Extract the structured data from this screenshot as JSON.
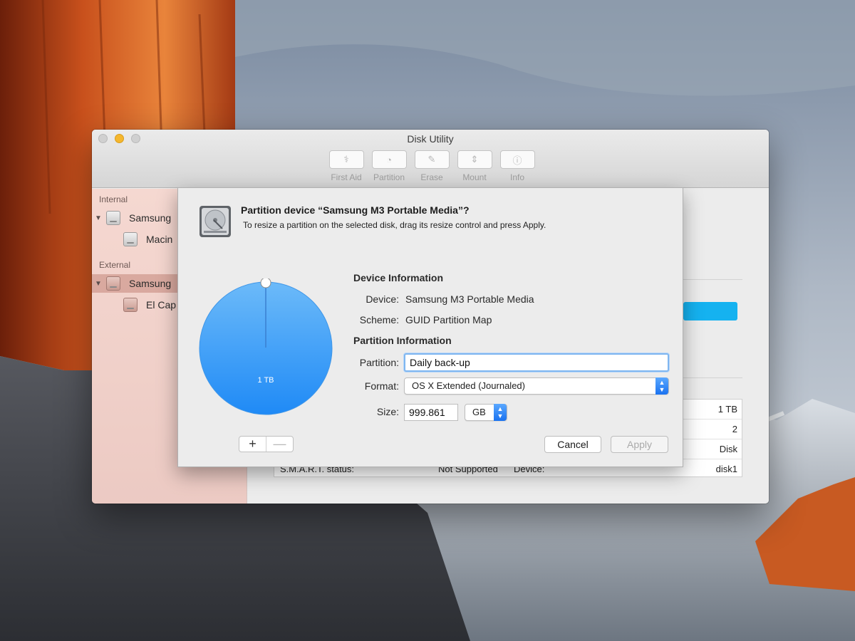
{
  "window": {
    "title": "Disk Utility",
    "toolbar": [
      {
        "label": "First Aid",
        "icon": "stethoscope-icon",
        "glyph": "⚕"
      },
      {
        "label": "Partition",
        "icon": "partition-pie-icon",
        "glyph": "◔"
      },
      {
        "label": "Erase",
        "icon": "erase-icon",
        "glyph": "✎"
      },
      {
        "label": "Mount",
        "icon": "mount-icon",
        "glyph": "⇕"
      },
      {
        "label": "Info",
        "icon": "info-icon",
        "glyph": "ⓘ"
      }
    ]
  },
  "sidebar": {
    "internal_label": "Internal",
    "external_label": "External",
    "items": [
      {
        "label": "Samsung",
        "type": "disk",
        "section": "internal"
      },
      {
        "label": "Macin",
        "type": "volume",
        "section": "internal"
      },
      {
        "label": "Samsung",
        "type": "disk",
        "section": "external",
        "selected": true
      },
      {
        "label": "El Cap",
        "type": "volume",
        "section": "external"
      }
    ]
  },
  "info_table": {
    "rows": [
      {
        "value": "1 TB"
      },
      {
        "value": "2"
      },
      {
        "value": "Disk"
      },
      {
        "label": "S.M.A.R.T. status:",
        "mid": "Not Supported",
        "label2": "Device:",
        "value": "disk1"
      }
    ]
  },
  "sheet": {
    "title": "Partition device “Samsung M3 Portable Media”?",
    "subtitle": "To resize a partition on the selected disk, drag its resize control and press Apply.",
    "pie": {
      "label": "1 TB",
      "color_top": "#6cbaf9",
      "color_bottom": "#1f8af6"
    },
    "device_info_title": "Device Information",
    "device_label": "Device:",
    "device_value": "Samsung M3 Portable Media",
    "scheme_label": "Scheme:",
    "scheme_value": "GUID Partition Map",
    "partition_info_title": "Partition Information",
    "partition_label": "Partition:",
    "partition_value": "Daily back-up",
    "format_label": "Format:",
    "format_value": "OS X Extended (Journaled)",
    "size_label": "Size:",
    "size_value": "999.861",
    "size_unit": "GB",
    "add_label": "+",
    "remove_label": "—",
    "cancel_label": "Cancel",
    "apply_label": "Apply"
  },
  "colors": {
    "accent": "#1a72f0",
    "focus_ring": "#7fb6f0",
    "traffic_minimize": "#f5b72e",
    "sidebar_selection": "#c88c80",
    "progress_blue": "#15b2f0"
  }
}
